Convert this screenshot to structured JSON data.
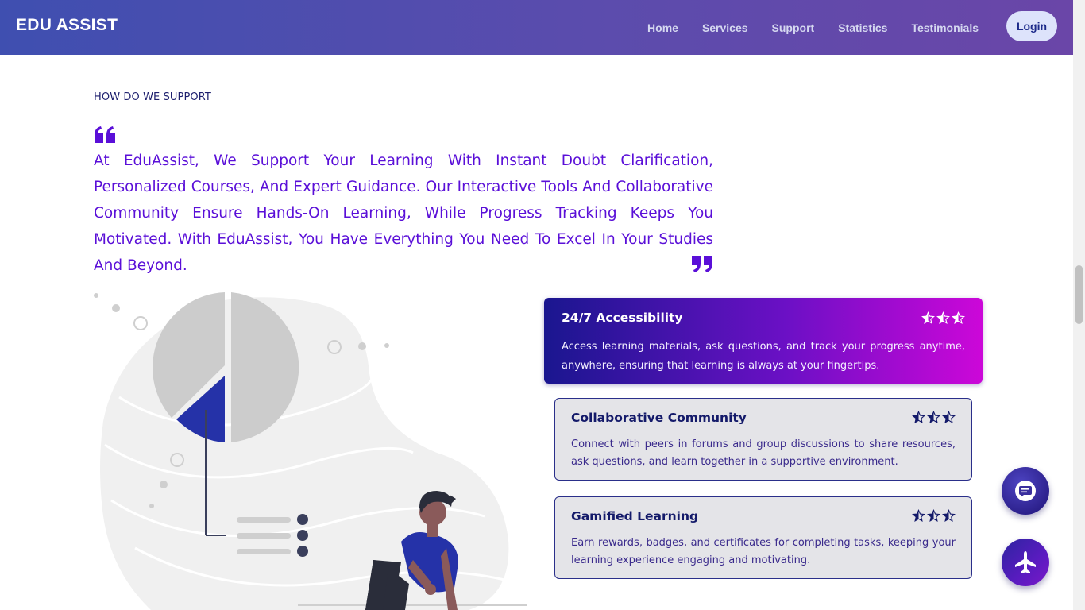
{
  "navbar": {
    "brand": "EDU ASSIST",
    "links": [
      "Home",
      "Services",
      "Support",
      "Statistics",
      "Testimonials"
    ],
    "login_label": "Login"
  },
  "support": {
    "section_label": "HOW DO WE SUPPORT",
    "intro": "At EduAssist, We Support Your Learning With Instant Doubt Clarification, Personalized Courses, And Expert Guidance. Our Interactive Tools And Collaborative Community Ensure Hands-On Learning, While Progress Tracking Keeps You Motivated. With EduAssist, You Have Everything You Need To Excel In Your Studies And Beyond."
  },
  "features": [
    {
      "title": "24/7 Accessibility",
      "description": "Access learning materials, ask questions, and track your progress anytime, anywhere, ensuring that learning is always at your fingertips.",
      "stars": 3,
      "active": true
    },
    {
      "title": "Collaborative Community",
      "description": "Connect with peers in forums and group discussions to share resources, ask questions, and learn together in a supportive environment.",
      "stars": 3,
      "active": false
    },
    {
      "title": "Gamified Learning",
      "description": "Earn rewards, badges, and certificates for completing tasks, keeping your learning experience engaging and motivating.",
      "stars": 3,
      "active": false
    }
  ],
  "floating_buttons": [
    {
      "icon": "chat-icon"
    },
    {
      "icon": "airplane-icon"
    }
  ],
  "colors": {
    "accent": "#5a0fd8",
    "navy": "#1d1f6e",
    "nav_gradient_start": "#3f4fb0",
    "nav_gradient_end": "#6a46a8",
    "card_gradient_start": "#1a168f",
    "card_gradient_end": "#cc07d8"
  }
}
